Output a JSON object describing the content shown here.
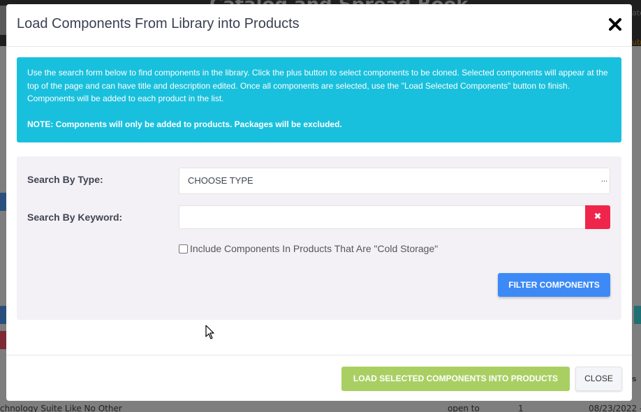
{
  "background": {
    "app_title": "Catalog and Spread Book",
    "row_title": "chnology Suite Like No Other",
    "row_status": "open to",
    "row_count": "1",
    "row_date": "08/23/2022 -"
  },
  "modal": {
    "title": "Load Components From Library into Products",
    "close_icon": "close-x-icon",
    "info": {
      "text": "Use the search form below to find components in the library. Click the plus button to select components to be cloned. Selected components will appear at the top of the page and can have title and description edited. Once all components are selected, use the \"Load Selected Components\" button to finish. Components will be added to each product in the list.",
      "note": "NOTE: Components will only be added to products. Packages will be excluded."
    },
    "search": {
      "type_label": "Search By Type:",
      "type_value": "CHOOSE TYPE",
      "type_dots": "...",
      "keyword_label": "Search By Keyword:",
      "keyword_value": "",
      "clear_icon": "clear-x-icon",
      "clear_symbol": "✖",
      "cold_storage_label": "Include Components In Products That Are \"Cold Storage\"",
      "cold_storage_checked": false,
      "filter_button": "FILTER COMPONENTS"
    },
    "footer": {
      "load_button": "LOAD SELECTED COMPONENTS INTO PRODUCTS",
      "close_button": "CLOSE"
    }
  },
  "colors": {
    "info_bg": "#19c0dd",
    "panel_bg": "#f3f1f5",
    "filter_button": "#3d8af7",
    "clear_button": "#f0254c",
    "load_button": "#a9cf63"
  }
}
